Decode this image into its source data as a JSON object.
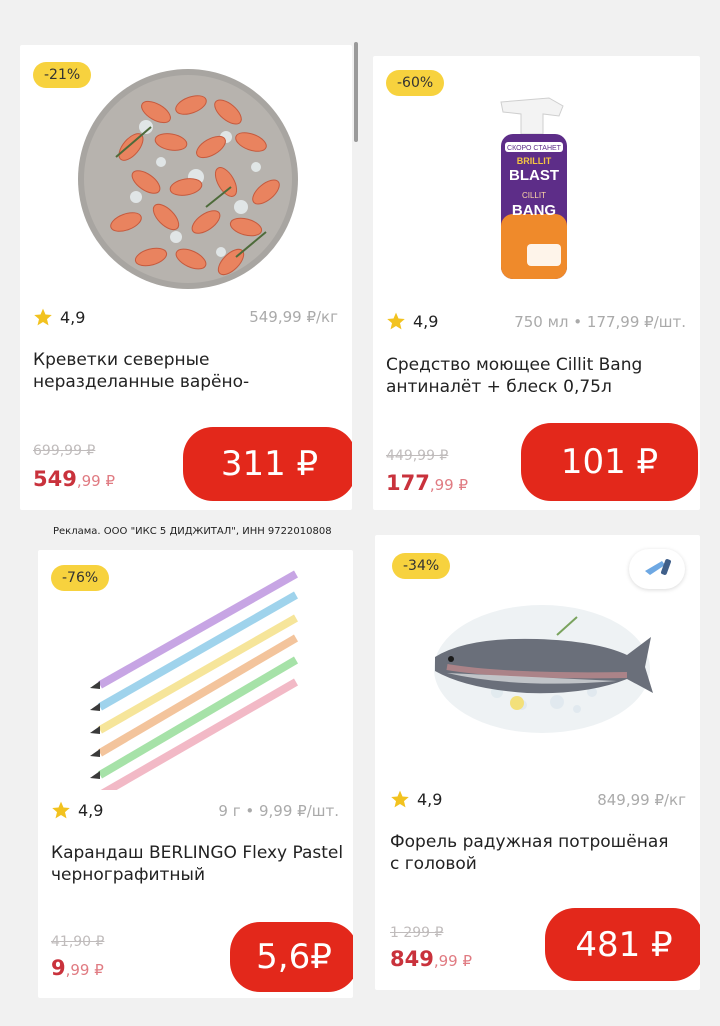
{
  "ad_note": "Реклама. ООО \"ИКС 5 ДИДЖИТАЛ\", ИНН 9722010808",
  "products": [
    {
      "discount": "-21%",
      "rating": "4,9",
      "unit_price": "549,99 ₽/кг",
      "name_line1": "Креветки северные",
      "name_line2": "неразделанные варёно-",
      "old_price": "699,99 ₽",
      "new_price_main": "549",
      "new_price_rest": ",99 ₽",
      "button_price": "311 ₽",
      "image_icon": "shrimp-plate-icon"
    },
    {
      "discount": "-60%",
      "rating": "4,9",
      "unit_price": "750 мл • 177,99 ₽/шт.",
      "name_line1": "Средство моющее Cillit Bang",
      "name_line2": "антиналёт + блеск 0,75л",
      "old_price": "449,99 ₽",
      "new_price_main": "177",
      "new_price_rest": ",99 ₽",
      "button_price": "101 ₽",
      "image_icon": "spray-bottle-icon",
      "label_top": "СКОРО СТАНЕТ",
      "label_brilliant": "BRILLIT",
      "label_blast": "BLAST",
      "label_cillit": "CILLIT",
      "label_bang": "BANG"
    },
    {
      "discount": "-76%",
      "rating": "4,9",
      "unit_price": "9 г • 9,99 ₽/шт.",
      "name_line1": "Карандаш BERLINGO Flexy Pastel",
      "name_line2": "чернографитный",
      "old_price": "41,90 ₽",
      "new_price_main": "9",
      "new_price_rest": ",99 ₽",
      "button_price": "5,6₽",
      "image_icon": "pencils-icon"
    },
    {
      "discount": "-34%",
      "rating": "4,9",
      "unit_price": "849,99 ₽/кг",
      "name_line1": "Форель радужная потрошёная",
      "name_line2": "с головой",
      "old_price": "1 299 ₽",
      "new_price_main": "849",
      "new_price_rest": ",99 ₽",
      "button_price": "481 ₽",
      "image_icon": "trout-fish-icon"
    }
  ],
  "colors": {
    "badge": "#f7d23e",
    "cta": "#e3281b",
    "price": "#c9323c"
  }
}
